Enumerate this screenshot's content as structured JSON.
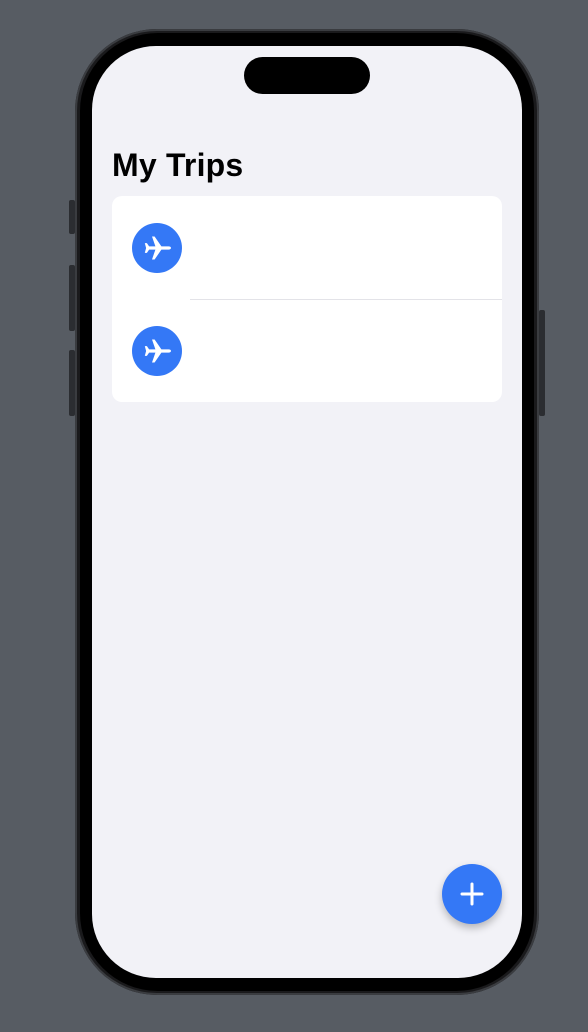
{
  "screen": {
    "title": "My Trips"
  },
  "trips": [
    {
      "icon": "airplane-icon",
      "label": ""
    },
    {
      "icon": "airplane-icon",
      "label": ""
    }
  ],
  "fab": {
    "icon": "plus-icon"
  },
  "colors": {
    "accent": "#3478f6",
    "background": "#f2f2f7",
    "card": "#ffffff",
    "desktop": "#575c63"
  }
}
